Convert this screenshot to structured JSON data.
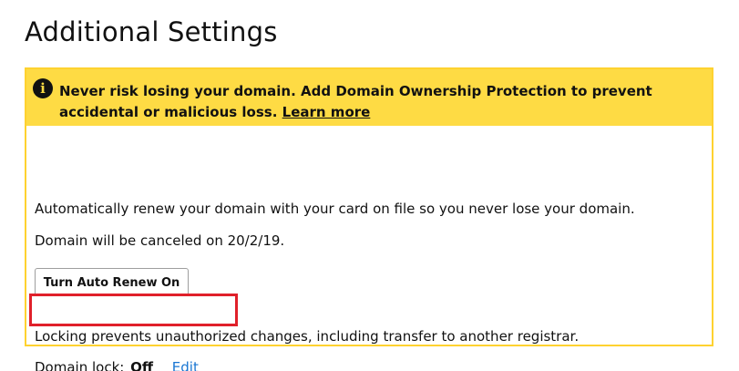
{
  "page": {
    "title": "Additional Settings"
  },
  "alert": {
    "icon": "info-icon",
    "icon_glyph": "i",
    "message": "Never risk losing your domain. Add Domain Ownership Protection to prevent accidental or malicious loss.",
    "link_label": "Learn more",
    "background": "#fedb44"
  },
  "auto_renew": {
    "description": "Automatically renew your domain with your card on file so you never lose your domain.",
    "cancel_notice": "Domain will be canceled on 20/2/19.",
    "button_label": "Turn Auto Renew On"
  },
  "domain_lock": {
    "description": "Locking prevents unauthorized changes, including transfer to another registrar.",
    "label": "Domain lock:",
    "status": "Off",
    "edit_label": "Edit",
    "link_color": "#1976d2"
  },
  "annotation": {
    "highlight_color": "#e0202a"
  }
}
